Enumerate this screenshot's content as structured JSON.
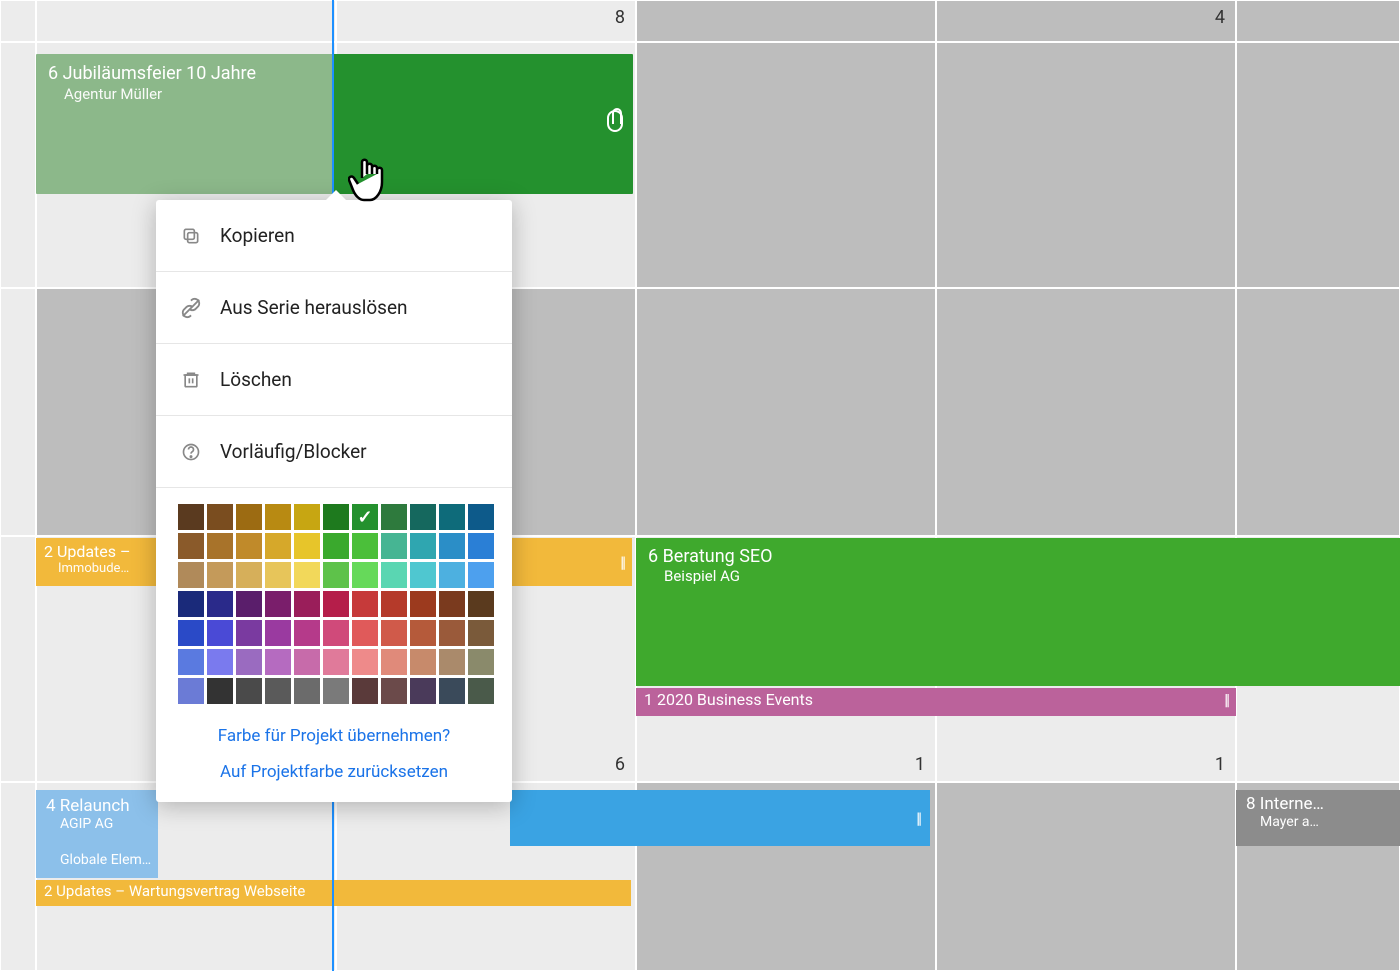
{
  "header_numbers": [
    "",
    "",
    "8",
    "",
    "4",
    ""
  ],
  "footer_numbers": {
    "c2": "6",
    "c3": "1",
    "c4": "1"
  },
  "today_marker": true,
  "events": {
    "anniversary": {
      "hours": "6",
      "title": "Jubiläumsfeier 10 Jahre",
      "sub": "Agentur Müller"
    },
    "updates1": {
      "hours": "2",
      "title": "Updates –",
      "sub": "Immobude…"
    },
    "beratung": {
      "hours": "6",
      "title": "Beratung SEO",
      "sub": "Beispiel AG"
    },
    "business": {
      "hours": "1",
      "title": "2020 Business Events"
    },
    "relaunch": {
      "hours": "4",
      "title": "Relaunch",
      "sub": "AGIP AG",
      "extra": "Globale Elem…"
    },
    "intern": {
      "hours": "8",
      "title": "Interne…",
      "sub": "Mayer a…"
    },
    "updates2": {
      "hours": "2",
      "title": "Updates – Wartungsvertrag Webseite"
    }
  },
  "menu": {
    "copy": "Kopieren",
    "unseries": "Aus Serie herauslösen",
    "delete": "Löschen",
    "tentative": "Vorläufig/Blocker",
    "link_adopt": "Farbe für Projekt übernehmen?",
    "link_reset": "Auf Projektfarbe zurücksetzen"
  },
  "palette_rows": [
    [
      "#5a3a1f",
      "#7a4d1f",
      "#9c6b12",
      "#b88a12",
      "#c7a612",
      "#1e7a1e",
      "#24912e",
      "#2e7a3d",
      "#15685e",
      "#0e6b7a",
      "#0d5a8a"
    ],
    [
      "#8a5a2a",
      "#a8732a",
      "#c08a2a",
      "#d6a82a",
      "#e7c52a",
      "#3aa92d",
      "#4bbf3a",
      "#46b593",
      "#2fa6b0",
      "#2b8ec7",
      "#2a7fd6"
    ],
    [
      "#b08a5a",
      "#c49a5a",
      "#d6af5a",
      "#e7c55a",
      "#f2d85a",
      "#5ec24a",
      "#66d95a",
      "#5ad6b2",
      "#4fc7d0",
      "#4db0e0",
      "#4da0ee"
    ],
    [
      "#1a2a7a",
      "#2a2a8a",
      "#5a1e6b",
      "#7a1e6b",
      "#9a1e5a",
      "#b51e4a",
      "#c63a3a",
      "#b53a2a",
      "#9c3a1e",
      "#7a3a1e",
      "#5a3a1e"
    ],
    [
      "#2a4ac7",
      "#4a4ad6",
      "#7a3aa0",
      "#9a3aa0",
      "#b53a8a",
      "#d04a7a",
      "#e05a5a",
      "#d05a4a",
      "#b55a3a",
      "#9a5a3a",
      "#7a5a3a"
    ],
    [
      "#5a7ae0",
      "#7a7aee",
      "#9a6bc0",
      "#b56bc0",
      "#c76baa",
      "#e07a9a",
      "#ee8a8a",
      "#e08a7a",
      "#c78a6b",
      "#aa8a6b",
      "#8a8a6b"
    ],
    [
      "#6b7bd6",
      "#333333",
      "#4a4a4a",
      "#5a5a5a",
      "#6b6b6b",
      "#7a7a7a",
      "#5a3a3a",
      "#6b4a4a",
      "#4a3a5a",
      "#3a4a5a",
      "#4a5a4a"
    ]
  ],
  "selected_color": {
    "row": 0,
    "col": 6
  }
}
